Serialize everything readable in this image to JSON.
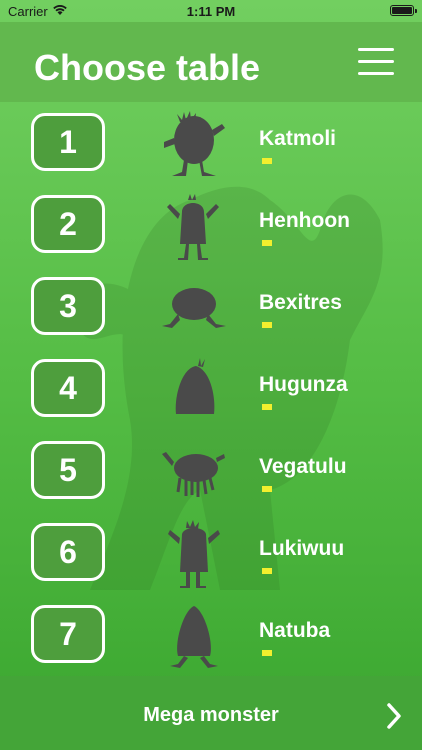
{
  "status_bar": {
    "carrier": "Carrier",
    "time": "1:11 PM"
  },
  "header": {
    "title": "Choose table",
    "menu_icon": "hamburger-menu-icon"
  },
  "tables": [
    {
      "number": "1",
      "name": "Katmoli",
      "monster_icon": "katmoli-silhouette-icon"
    },
    {
      "number": "2",
      "name": "Henhoon",
      "monster_icon": "henhoon-silhouette-icon"
    },
    {
      "number": "3",
      "name": "Bexitres",
      "monster_icon": "bexitres-silhouette-icon"
    },
    {
      "number": "4",
      "name": "Hugunza",
      "monster_icon": "hugunza-silhouette-icon"
    },
    {
      "number": "5",
      "name": "Vegatulu",
      "monster_icon": "vegatulu-silhouette-icon"
    },
    {
      "number": "6",
      "name": "Lukiwuu",
      "monster_icon": "lukiwuu-silhouette-icon"
    },
    {
      "number": "7",
      "name": "Natuba",
      "monster_icon": "natuba-silhouette-icon"
    }
  ],
  "bottom": {
    "label": "Mega monster",
    "chevron_icon": "chevron-right-icon"
  },
  "colors": {
    "background_top": "#72cf60",
    "background_bottom": "#3aa62f",
    "header": "#62b84e",
    "button_fill": "#4e9e3d",
    "progress": "#f2ef2e",
    "silhouette": "#4a4a4a"
  }
}
